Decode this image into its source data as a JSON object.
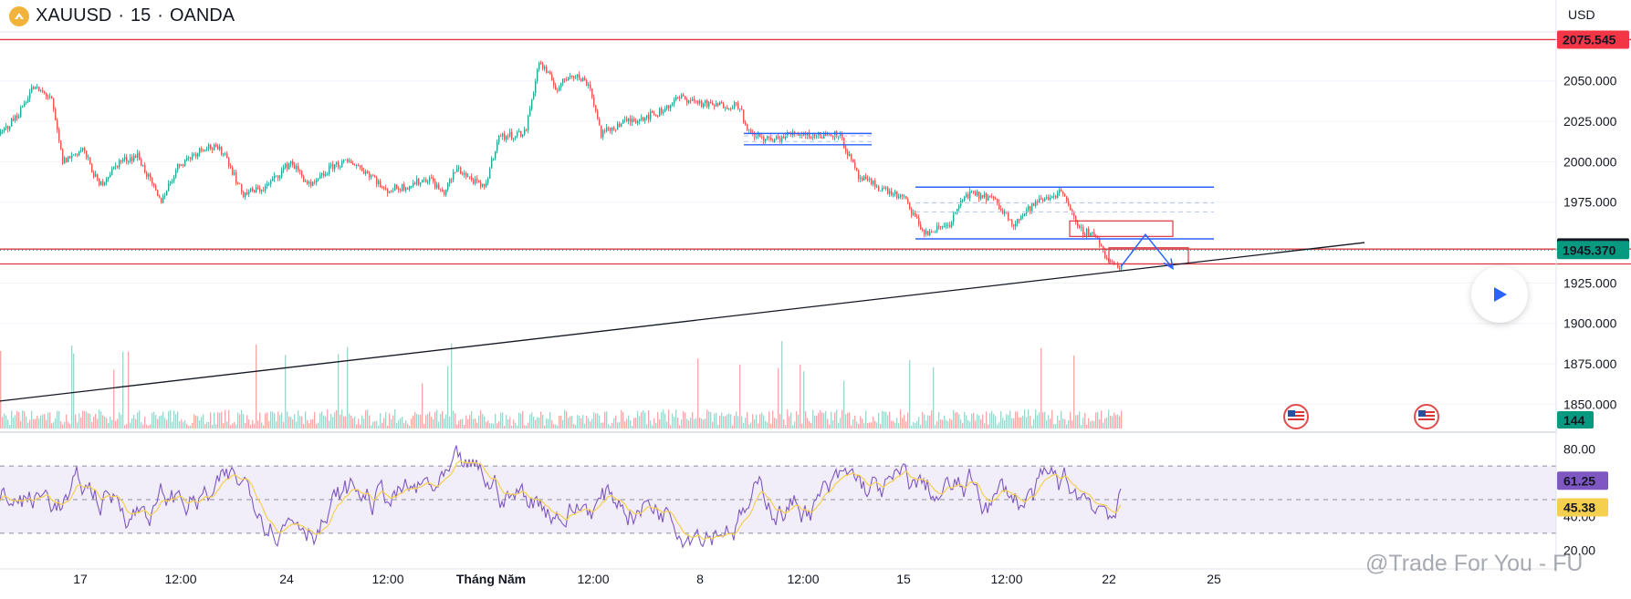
{
  "header": {
    "symbol": "XAUUSD",
    "sep": "·",
    "interval": "15",
    "broker": "OANDA"
  },
  "currency": "USD",
  "icons": {
    "logo": "oanda-logo-icon",
    "play": "play-icon",
    "events": "us-flag-icon"
  },
  "watermark": "@Trade For You - FU",
  "colors": {
    "up": "#26a69a",
    "down": "#ef5350",
    "rsi": "#7e57c2",
    "rsi_ma": "#f5cf4e",
    "box": "#2962ff",
    "resistance": "#e0353f"
  },
  "chart_data": [
    {
      "type": "candlestick",
      "title": "XAUUSD · 15 · OANDA",
      "y_axis": {
        "ticks": [
          2050,
          2025,
          2000,
          1975,
          1925,
          1900,
          1875,
          1850
        ],
        "labels": [
          "2050.000",
          "2025.000",
          "2000.000",
          "1975.000",
          "1925.000",
          "1900.000",
          "1875.000",
          "1850.000"
        ],
        "ylim": [
          1835,
          2082
        ]
      },
      "x_axis": {
        "labels": [
          "17",
          "12:00",
          "24",
          "12:00",
          "Tháng Năm",
          "12:00",
          "8",
          "12:00",
          "15",
          "12:00",
          "22",
          "25"
        ]
      },
      "close_path": [
        {
          "t": 0,
          "p": 2017
        },
        {
          "t": 20,
          "p": 2030
        },
        {
          "t": 35,
          "p": 2046
        },
        {
          "t": 55,
          "p": 2040
        },
        {
          "t": 68,
          "p": 2000
        },
        {
          "t": 90,
          "p": 2008
        },
        {
          "t": 108,
          "p": 1985
        },
        {
          "t": 130,
          "p": 2000
        },
        {
          "t": 150,
          "p": 2004
        },
        {
          "t": 175,
          "p": 1975
        },
        {
          "t": 195,
          "p": 1998
        },
        {
          "t": 225,
          "p": 2010
        },
        {
          "t": 245,
          "p": 2006
        },
        {
          "t": 265,
          "p": 1980
        },
        {
          "t": 290,
          "p": 1984
        },
        {
          "t": 318,
          "p": 2000
        },
        {
          "t": 340,
          "p": 1984
        },
        {
          "t": 365,
          "p": 1998
        },
        {
          "t": 385,
          "p": 2000
        },
        {
          "t": 410,
          "p": 1990
        },
        {
          "t": 420,
          "p": 1982
        },
        {
          "t": 445,
          "p": 1985
        },
        {
          "t": 470,
          "p": 1990
        },
        {
          "t": 485,
          "p": 1980
        },
        {
          "t": 500,
          "p": 1996
        },
        {
          "t": 530,
          "p": 1983
        },
        {
          "t": 545,
          "p": 2015
        },
        {
          "t": 575,
          "p": 2018
        },
        {
          "t": 590,
          "p": 2062
        },
        {
          "t": 610,
          "p": 2045
        },
        {
          "t": 625,
          "p": 2055
        },
        {
          "t": 645,
          "p": 2048
        },
        {
          "t": 658,
          "p": 2017
        },
        {
          "t": 680,
          "p": 2024
        },
        {
          "t": 720,
          "p": 2030
        },
        {
          "t": 745,
          "p": 2040
        },
        {
          "t": 775,
          "p": 2035
        },
        {
          "t": 810,
          "p": 2035
        },
        {
          "t": 818,
          "p": 2018
        },
        {
          "t": 845,
          "p": 2013
        },
        {
          "t": 870,
          "p": 2018
        },
        {
          "t": 895,
          "p": 2016
        },
        {
          "t": 918,
          "p": 2018
        },
        {
          "t": 940,
          "p": 1990
        },
        {
          "t": 960,
          "p": 1985
        },
        {
          "t": 990,
          "p": 1977
        },
        {
          "t": 1013,
          "p": 1955
        },
        {
          "t": 1040,
          "p": 1962
        },
        {
          "t": 1058,
          "p": 1980
        },
        {
          "t": 1085,
          "p": 1978
        },
        {
          "t": 1110,
          "p": 1962
        },
        {
          "t": 1135,
          "p": 1975
        },
        {
          "t": 1165,
          "p": 1982
        },
        {
          "t": 1180,
          "p": 1958
        },
        {
          "t": 1200,
          "p": 1955
        },
        {
          "t": 1213,
          "p": 1938
        },
        {
          "t": 1228,
          "p": 1935
        }
      ],
      "price_labels": [
        {
          "value": 2075.545,
          "label": "2075.545",
          "color": "#f23645"
        },
        {
          "value": 1947.024,
          "label": "1947.024",
          "color": "#131722"
        },
        {
          "value": 1945.37,
          "label": "1945.370",
          "color": "#089981"
        }
      ],
      "drawings": {
        "resistance_lines": [
          2075.545,
          1946.0,
          1936.8
        ],
        "range_boxes": [
          {
            "t0": 815,
            "t1": 955,
            "top": 2017.5,
            "bottom": 2010.5,
            "mid": [
              2016.0,
              2012.5
            ],
            "color": "#2962ff"
          },
          {
            "t0": 1003,
            "t1": 1330,
            "top": 1984.3,
            "bottom": 1952.3,
            "mid": [
              1974.5,
              1969.0
            ],
            "color": "#2962ff"
          }
        ],
        "red_boxes": [
          {
            "t0": 1172,
            "t1": 1285,
            "top": 1963.4,
            "bottom": 1953.8
          },
          {
            "t0": 1215,
            "t1": 1302,
            "top": 1946.8,
            "bottom": 1936.8
          }
        ],
        "trendline": [
          {
            "t": 0,
            "p": 1852
          },
          {
            "t": 1495,
            "p": 1950
          }
        ],
        "projection": [
          {
            "t": 1228,
            "p": 1935
          },
          {
            "t": 1255,
            "p": 1955
          },
          {
            "t": 1285,
            "p": 1934
          }
        ]
      }
    },
    {
      "type": "bar",
      "title": "Volume",
      "last_value": 144,
      "last_label": "144"
    },
    {
      "type": "line",
      "title": "RSI",
      "y_axis": {
        "ticks": [
          80,
          40,
          20
        ],
        "labels": [
          "80.00",
          "40.00",
          "20.00"
        ],
        "ylim": [
          12,
          88
        ],
        "bands": [
          70,
          30
        ],
        "midline": 50
      },
      "series": [
        {
          "value": 61.25,
          "label": "61.25",
          "color": "#7e57c2"
        },
        {
          "value": 45.38,
          "label": "45.38",
          "color": "#f5cf4e"
        }
      ]
    }
  ]
}
